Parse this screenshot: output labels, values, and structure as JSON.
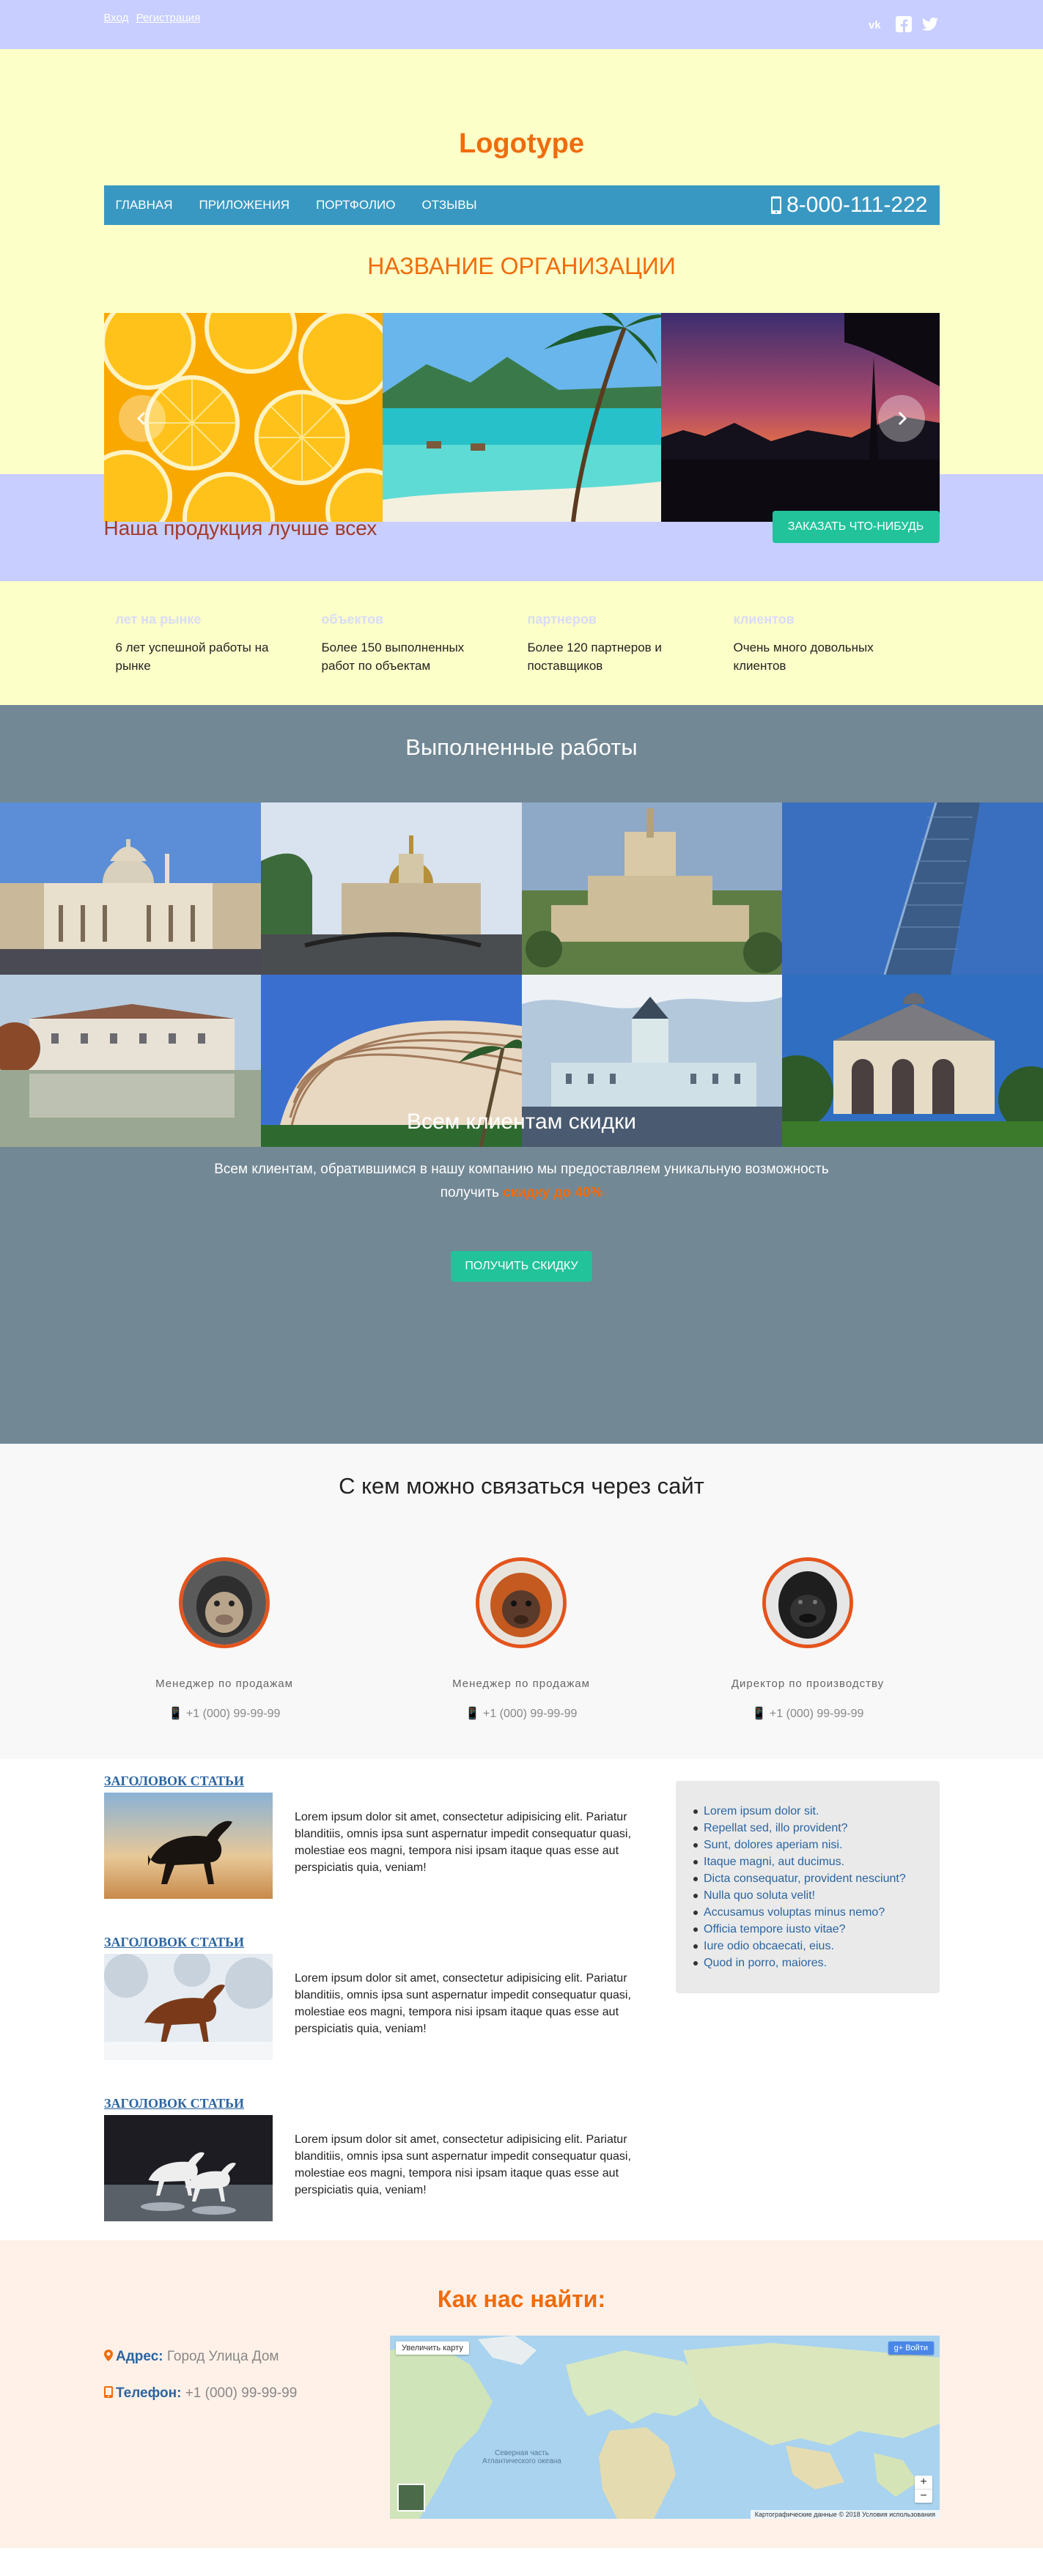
{
  "topbar": {
    "login": "Вход",
    "register": "Регистрация"
  },
  "logo": "Logotype",
  "nav": {
    "items": [
      "ГЛАВНАЯ",
      "ПРИЛОЖЕНИЯ",
      "ПОРТФОЛИО",
      "ОТЗЫВЫ"
    ],
    "phone": "8-000-111-222"
  },
  "org_name": "НАЗВАНИЕ ОРГАНИЗАЦИИ",
  "cta": {
    "text": "Наша продукция лучше всех",
    "button": "ЗАКАЗАТЬ ЧТО-НИБУДЬ"
  },
  "stats": [
    {
      "label": "лет на рынке",
      "desc": "6 лет успешной работы на рынке"
    },
    {
      "label": "объектов",
      "desc": "Более 150 выполненных работ по объектам"
    },
    {
      "label": "партнеров",
      "desc": "Более 120 партнеров и поставщиков"
    },
    {
      "label": "клиентов",
      "desc": "Очень много довольных клиентов"
    }
  ],
  "works": {
    "title": "Выполненные работы"
  },
  "discount": {
    "title": "Всем клиентам скидки",
    "text": "Всем клиентам, обратившимся в нашу компанию мы предоставляем уникальную возможность получить",
    "highlight": "скидку до 40%",
    "button": "ПОЛУЧИТЬ СКИДКУ"
  },
  "contacts": {
    "title": "С кем можно связаться через сайт",
    "people": [
      {
        "role": "Менеджер по продажам",
        "phone": "+1 (000) 99-99-99"
      },
      {
        "role": "Менеджер по продажам",
        "phone": "+1 (000) 99-99-99"
      },
      {
        "role": "Директор по производству",
        "phone": "+1 (000) 99-99-99"
      }
    ]
  },
  "articles": [
    {
      "title": "ЗАГОЛОВОК СТАТЬИ",
      "text": "Lorem ipsum dolor sit amet, consectetur adipisicing elit. Pariatur blanditiis, omnis ipsa sunt aspernatur impedit consequatur quasi, molestiae eos magni, tempora nisi ipsam itaque quas esse aut perspiciatis quia, veniam!"
    },
    {
      "title": "ЗАГОЛОВОК СТАТЬИ",
      "text": "Lorem ipsum dolor sit amet, consectetur adipisicing elit. Pariatur blanditiis, omnis ipsa sunt aspernatur impedit consequatur quasi, molestiae eos magni, tempora nisi ipsam itaque quas esse aut perspiciatis quia, veniam!"
    },
    {
      "title": "ЗАГОЛОВОК СТАТЬИ",
      "text": "Lorem ipsum dolor sit amet, consectetur adipisicing elit. Pariatur blanditiis, omnis ipsa sunt aspernatur impedit consequatur quasi, molestiae eos magni, tempora nisi ipsam itaque quas esse aut perspiciatis quia, veniam!"
    }
  ],
  "sidebar": {
    "links": [
      "Lorem ipsum dolor sit.",
      "Repellat sed, illo provident?",
      "Sunt, dolores aperiam nisi.",
      "Itaque magni, aut ducimus.",
      "Dicta consequatur, provident nesciunt?",
      "Nulla quo soluta velit!",
      "Accusamus voluptas minus nemo?",
      "Officia tempore iusto vitae?",
      "Iure odio obcaecati, eius.",
      "Quod in porro, maiores."
    ]
  },
  "find": {
    "title": "Как нас найти:",
    "address_label": "Адрес:",
    "address": "Город Улица Дом",
    "phone_label": "Телефон:",
    "phone": "+1 (000) 99-99-99",
    "map_enlarge": "Увеличить карту",
    "map_login": "Войти",
    "map_ocean": "Северная часть Атлантического океана",
    "map_footer": "Картографические данные © 2018   Условия использования"
  },
  "colors": {
    "accent": "#ef6c0d",
    "button": "#22c39b",
    "nav": "#3998c2",
    "link": "#2b64a0"
  }
}
